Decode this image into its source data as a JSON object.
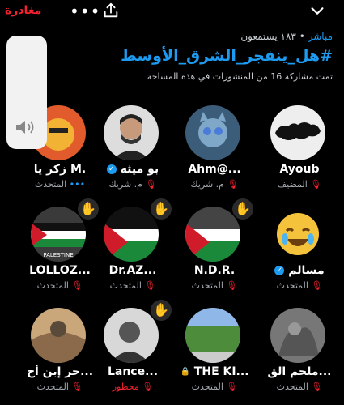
{
  "topbar": {
    "leave_label": "مغادرة",
    "more_label": "•••"
  },
  "header": {
    "live_label": "مباشر",
    "listeners_text": "١٨٣ يستمعون",
    "title": "#هل_ينفجر_الشرق_الأوسط",
    "subtitle": "تمت مشاركة 16 من المنشورات في هذه المساحة"
  },
  "participants": [
    {
      "name": "Ayoub",
      "role": "المضيف",
      "hand": false,
      "verified": false
    },
    {
      "name": "Ahm@...",
      "role": "م. شريك",
      "hand": false,
      "verified": false
    },
    {
      "name": "بو ميثه",
      "role": "م. شريك",
      "hand": false,
      "verified": true
    },
    {
      "name": "زكر يا M.",
      "role": "المتحدث",
      "hand": false,
      "verified": false
    },
    {
      "name": "مسالم",
      "role": "المتحدث",
      "hand": false,
      "verified": true
    },
    {
      "name": "N.D.R.",
      "role": "المتحدث",
      "hand": true,
      "verified": false
    },
    {
      "name": "Dr.AZ...",
      "role": "المتحدث",
      "hand": true,
      "verified": false
    },
    {
      "name": "LOLLOZ...",
      "role": "المتحدث",
      "hand": true,
      "verified": false
    },
    {
      "name": "ملحم الق...",
      "role": "المتحدث",
      "hand": false,
      "verified": false
    },
    {
      "name": "THE KI...",
      "role": "المتحدث",
      "hand": false,
      "verified": false
    },
    {
      "name": "Lance...",
      "role": "محظور",
      "hand": true,
      "verified": false
    },
    {
      "name": "حر إبن أح...",
      "role": "المتحدث",
      "hand": false,
      "verified": false
    }
  ],
  "labels": {
    "palestine": "PALESTINE"
  },
  "colors": {
    "accent": "#1d9bf0",
    "danger": "#f4212e",
    "background": "#000000"
  }
}
